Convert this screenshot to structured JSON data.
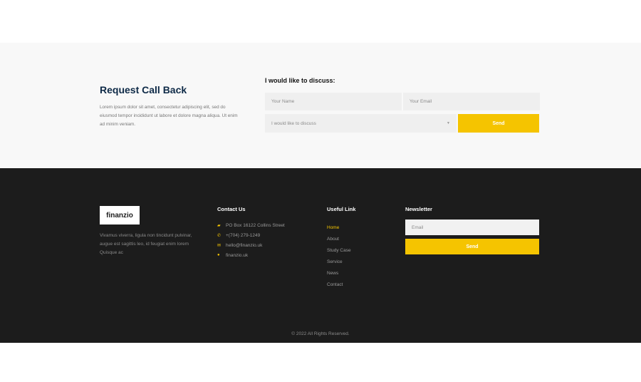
{
  "callback": {
    "title": "Request Call Back",
    "text": "Lorem ipsum dolor sit amet, consectetur adipiscing elit, sed do eiusmod tempor incididunt ut labore et dolore magna aliqua. Ut enim ad minim veniam.",
    "form_title": "I would like to discuss:",
    "name_placeholder": "Your Name",
    "email_placeholder": "Your Email",
    "discuss_value": "I would like to discuss",
    "send_label": "Send"
  },
  "footer": {
    "logo_text": "finanzio",
    "about_text": "Vivamus viverra, ligula non tincidunt pulvinar, augue est sagittis leo, id feugiat enim lorem Quisque ac",
    "contact": {
      "heading": "Contact Us",
      "items": [
        {
          "icon": "map-marker-icon",
          "glyph": "▰",
          "text": "PO Box 16122 Collins Street"
        },
        {
          "icon": "phone-icon",
          "glyph": "✆",
          "text": "+(704) 279-1249"
        },
        {
          "icon": "envelope-icon",
          "glyph": "✉",
          "text": "hello@finanzio.uk"
        },
        {
          "icon": "globe-icon",
          "glyph": "●",
          "text": "finanzio.uk"
        }
      ]
    },
    "links": {
      "heading": "Useful Link",
      "items": [
        "Home",
        "About",
        "Study Case",
        "Service",
        "News",
        "Contact"
      ]
    },
    "newsletter": {
      "heading": "Newsletter",
      "email_placeholder": "Email",
      "send_label": "Send"
    },
    "copyright": "© 2022 All Rights Reserved."
  },
  "colors": {
    "accent": "#f5c400",
    "footer_bg": "#1c1c1c",
    "section_bg": "#f8f8f8",
    "title_navy": "#0e2a47"
  }
}
